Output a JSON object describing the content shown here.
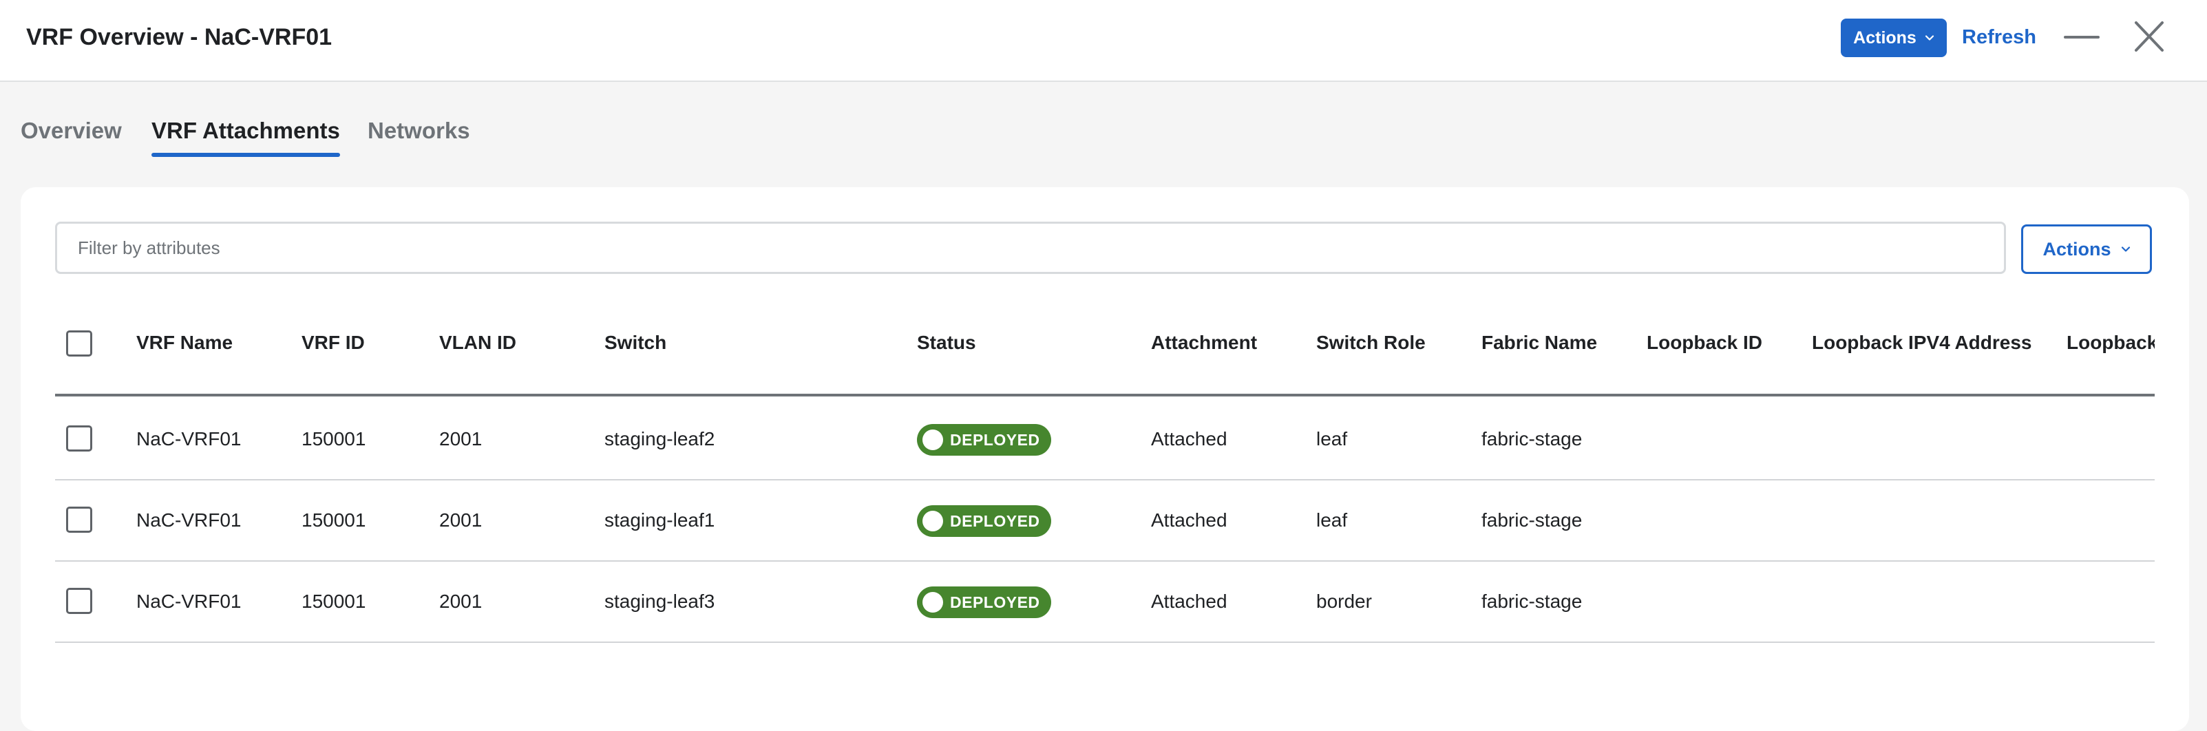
{
  "header": {
    "title": "VRF Overview - NaC-VRF01",
    "actions_label": "Actions",
    "refresh_label": "Refresh"
  },
  "tabs": [
    {
      "label": "Overview",
      "active": false
    },
    {
      "label": "VRF Attachments",
      "active": true
    },
    {
      "label": "Networks",
      "active": false
    }
  ],
  "filter": {
    "placeholder": "Filter by attributes",
    "value": ""
  },
  "table_actions_label": "Actions",
  "table": {
    "columns": [
      "VRF Name",
      "VRF ID",
      "VLAN ID",
      "Switch",
      "Status",
      "Attachment",
      "Switch Role",
      "Fabric Name",
      "Loopback ID",
      "Loopback IPV4 Address",
      "Loopback"
    ],
    "rows": [
      {
        "vrf_name": "NaC-VRF01",
        "vrf_id": "150001",
        "vlan_id": "2001",
        "switch": "staging-leaf2",
        "status": "DEPLOYED",
        "attachment": "Attached",
        "switch_role": "leaf",
        "fabric_name": "fabric-stage"
      },
      {
        "vrf_name": "NaC-VRF01",
        "vrf_id": "150001",
        "vlan_id": "2001",
        "switch": "staging-leaf1",
        "status": "DEPLOYED",
        "attachment": "Attached",
        "switch_role": "leaf",
        "fabric_name": "fabric-stage"
      },
      {
        "vrf_name": "NaC-VRF01",
        "vrf_id": "150001",
        "vlan_id": "2001",
        "switch": "staging-leaf3",
        "status": "DEPLOYED",
        "attachment": "Attached",
        "switch_role": "border",
        "fabric_name": "fabric-stage"
      }
    ]
  },
  "colors": {
    "accent": "#1f66c9",
    "status_deployed": "#46862e",
    "background": "#f5f5f5"
  },
  "icons": [
    "chevron-down-icon",
    "minimize-icon",
    "close-icon",
    "status-dot-icon"
  ]
}
